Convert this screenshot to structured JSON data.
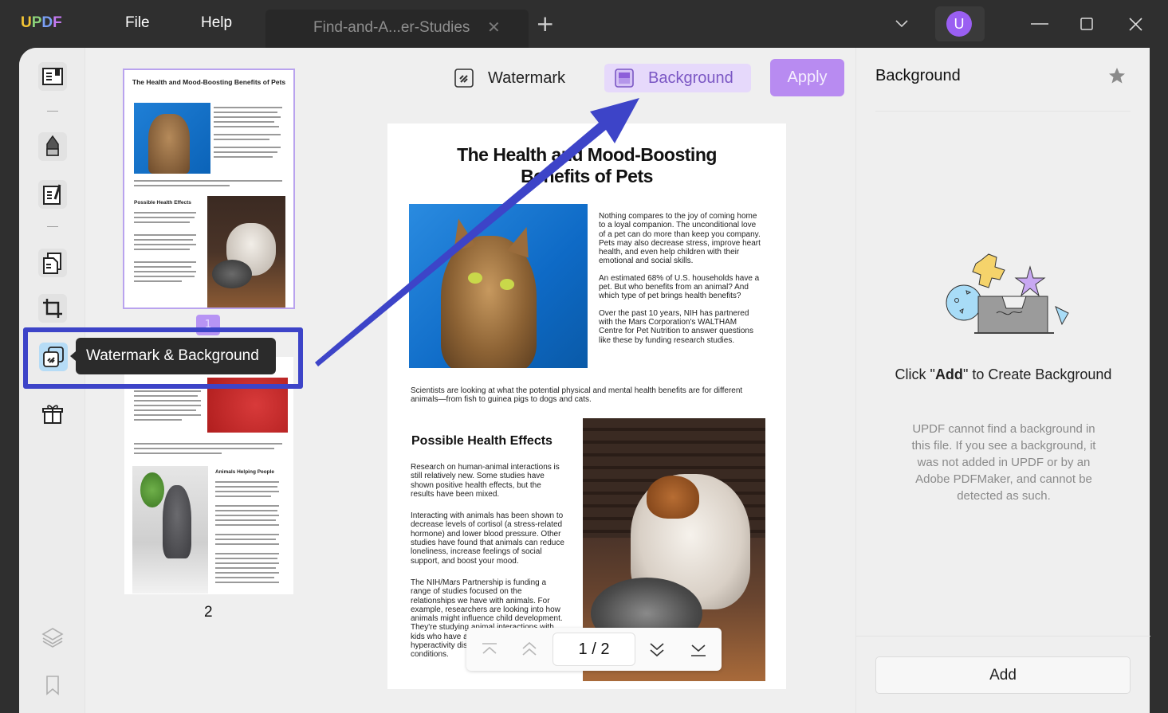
{
  "app": {
    "logo": [
      "U",
      "P",
      "D",
      "F"
    ],
    "menu": {
      "file": "File",
      "help": "Help"
    },
    "tab": {
      "title": "Find-and-A...er-Studies",
      "close": "✕",
      "add": "+"
    },
    "user_initial": "U",
    "colors": {
      "accent": "#b88bf1",
      "highlight_box": "#3d44c8",
      "arrow": "#3d44c8",
      "avatar": "#9a5ff2"
    }
  },
  "sidebar": {
    "tooltip": "Watermark & Background",
    "items": [
      {
        "name": "reader",
        "icon": "book-icon"
      },
      {
        "name": "comment",
        "icon": "highlighter-icon"
      },
      {
        "name": "edit",
        "icon": "edit-doc-icon"
      },
      {
        "name": "organize",
        "icon": "pages-icon"
      },
      {
        "name": "crop",
        "icon": "crop-icon"
      },
      {
        "name": "watermark-background",
        "icon": "watermark-icon",
        "active": true
      },
      {
        "name": "gift",
        "icon": "gift-icon"
      },
      {
        "name": "layers",
        "icon": "layers-icon"
      },
      {
        "name": "bookmark",
        "icon": "bookmark-icon"
      }
    ]
  },
  "thumbnails": {
    "page1_label": "1",
    "page2_label": "2",
    "page1_title": "The Health and Mood-Boosting Benefits of Pets",
    "page1_subheading": "Possible Health Effects",
    "page2_subheading": "Animals Helping People"
  },
  "toolbar": {
    "watermark": "Watermark",
    "background": "Background",
    "apply": "Apply"
  },
  "document": {
    "title_line1": "The Health and Mood-Boosting",
    "title_line2": "Benefits of Pets",
    "intro_p1": "Nothing compares to the joy of coming home to a loyal companion. The unconditional love of a pet can do more than keep you company. Pets may also decrease stress, improve heart health, and even help children with their emotional and social skills.",
    "intro_p2": "An estimated 68% of U.S. households have a pet. But who benefits from an animal? And which type of pet brings health benefits?",
    "intro_p3": "Over the past 10 years, NIH has partnered with the Mars Corporation's WALTHAM Centre for Pet Nutrition to answer questions like these by funding research studies.",
    "scientists": "Scientists are looking at what the potential physical and mental health benefits are for different animals—from fish to guinea pigs to dogs and cats.",
    "section_heading": "Possible Health Effects",
    "section_p1": "Research on human-animal interactions is still relatively new. Some studies have shown positive health effects, but the results have been mixed.",
    "section_p2": "Interacting with animals has been shown to decrease levels of cortisol (a stress-related hormone) and lower blood pressure. Other studies have found that animals can reduce loneliness, increase feelings of social support, and boost your mood.",
    "section_p3": "The NIH/Mars Partnership is funding a range of studies focused on the relationships we have with animals. For example, researchers are looking into how animals might influence child development. They're studying animal interactions with kids who have autism, attention deficit hyperactivity disorder (ADHD), and other conditions."
  },
  "pager": {
    "current": "1",
    "separator": "/",
    "total": "2",
    "display": "1 / 2"
  },
  "right_panel": {
    "title": "Background",
    "heading_pre": "Click \"",
    "heading_bold": "Add",
    "heading_post": "\" to Create Background",
    "description": "UPDF cannot find a background in this file. If you see a background, it was not added in UPDF or by an Adobe PDFMaker, and cannot be detected as such.",
    "add_button": "Add"
  }
}
